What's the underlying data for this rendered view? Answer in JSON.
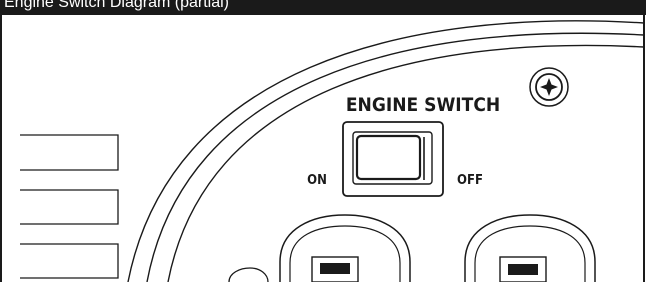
{
  "header": {
    "text": "Engine Switch Diagram (partial)"
  },
  "labels": {
    "title": "ENGINE SWITCH",
    "on": "ON",
    "off": "OFF"
  },
  "colors": {
    "ink": "#1a1a1a",
    "background": "#ffffff",
    "header_bar": "#1a1a1a"
  },
  "icons": {
    "screw": "phillips-screw-icon"
  }
}
